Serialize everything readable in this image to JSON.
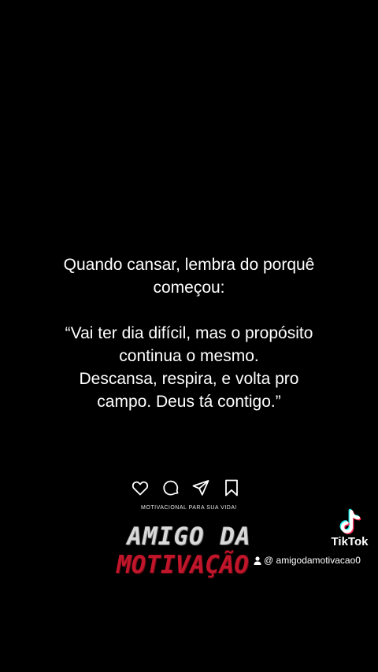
{
  "quote": {
    "intro_line1": "Quando cansar, lembra do porquê",
    "intro_line2": "começou:",
    "line1": "“Vai ter dia difícil, mas o propósito",
    "line2": "continua o mesmo.",
    "line3": "Descansa, respira, e volta pro",
    "line4": "campo. Deus tá contigo.”"
  },
  "actions": {
    "icons": [
      "heart-icon",
      "comment-icon",
      "share-icon",
      "bookmark-icon"
    ]
  },
  "brand": {
    "tagline": "MOTIVACIONAL PARA SUA VIDA!",
    "logo_line1": "AMIGO DA",
    "logo_line2": "MOTIVAÇÃO",
    "logo_line1_color": "#d9d9d9",
    "logo_line2_color": "#c0152a"
  },
  "tiktok": {
    "wordmark": "TikTok",
    "handle": "@ amigodamotivacao0",
    "cyan": "#25f4ee",
    "pink": "#fe2c55"
  },
  "colors": {
    "background": "#000000",
    "text": "#ffffff"
  }
}
